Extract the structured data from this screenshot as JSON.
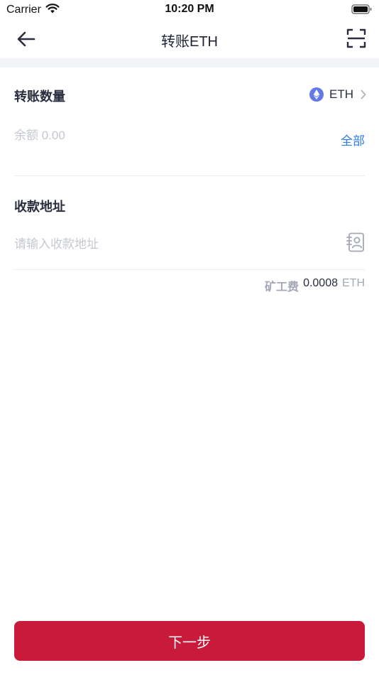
{
  "status_bar": {
    "carrier": "Carrier",
    "time": "10:20 PM"
  },
  "nav": {
    "title": "转账ETH",
    "back_icon": "arrow-left-icon",
    "scan_icon": "scan-icon"
  },
  "amount": {
    "label": "转账数量",
    "token": "ETH",
    "token_icon": "ethereum-icon",
    "balance_placeholder": "余额 0.00",
    "all_label": "全部"
  },
  "address": {
    "label": "收款地址",
    "placeholder": "请输入收款地址",
    "contacts_icon": "address-book-icon"
  },
  "fee": {
    "label": "矿工费",
    "value": "0.0008",
    "unit": "ETH"
  },
  "next_button": "下一步",
  "colors": {
    "primary_button": "#c81a3a",
    "link": "#2b7de9",
    "eth_icon": "#6479e8",
    "background_band": "#f3f4f7"
  }
}
